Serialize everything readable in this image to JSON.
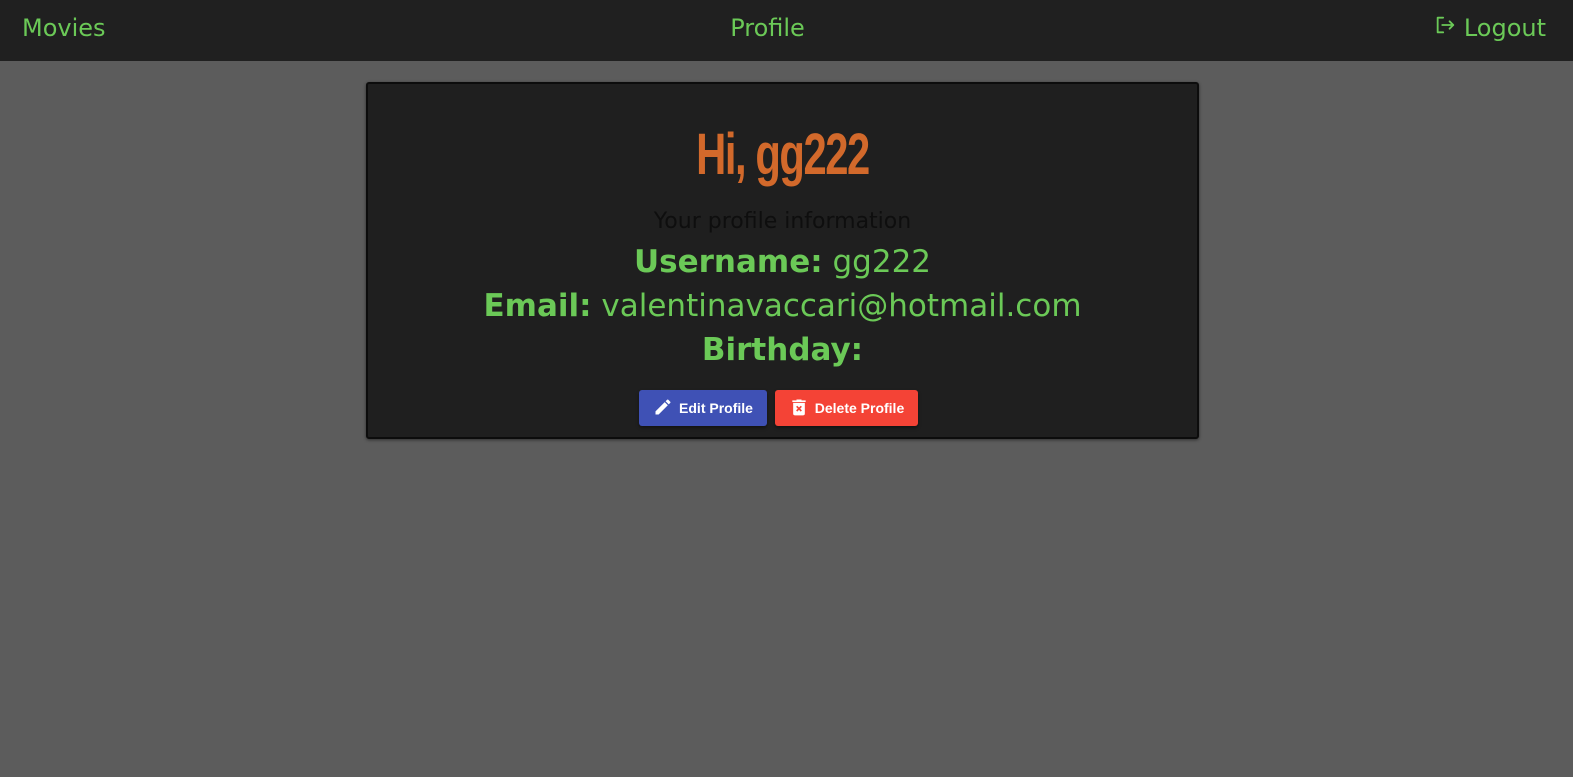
{
  "nav": {
    "movies_label": "Movies",
    "profile_label": "Profile",
    "logout_label": "Logout",
    "logout_icon": "logout-icon"
  },
  "profile": {
    "greeting": "Hi, gg222",
    "subtitle": "Your profile information",
    "username_label": "Username:",
    "username_value": "gg222",
    "email_label": "Email:",
    "email_value": "valentinavaccari@hotmail.com",
    "birthday_label": "Birthday:",
    "birthday_value": ""
  },
  "actions": {
    "edit_label": "Edit Profile",
    "edit_icon": "pencil-icon",
    "delete_label": "Delete Profile",
    "delete_icon": "trash-icon"
  },
  "colors": {
    "accent_green": "#6bc957",
    "greeting_orange": "#d2692b",
    "edit_blue": "#3f51b5",
    "delete_red": "#f44336",
    "navbar_bg": "#202020",
    "page_bg": "#5c5c5c",
    "card_bg": "#1f1f1f"
  }
}
